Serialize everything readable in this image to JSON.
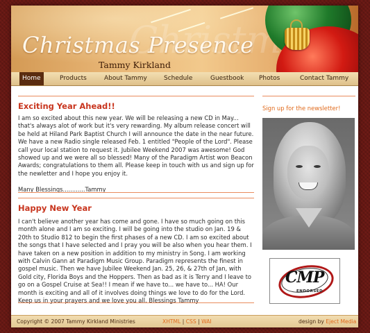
{
  "header": {
    "site_title": "Christmas Presence",
    "artist_name": "Tammy Kirkland",
    "ghost_text": "Christmas"
  },
  "nav": {
    "items": [
      {
        "label": "Home",
        "active": true
      },
      {
        "label": "Products",
        "active": false
      },
      {
        "label": "About Tammy",
        "active": false
      },
      {
        "label": "Schedule",
        "active": false
      },
      {
        "label": "Guestbook",
        "active": false
      },
      {
        "label": "Photos",
        "active": false
      },
      {
        "label": "Contact Tammy",
        "active": false
      }
    ]
  },
  "main": {
    "posts": [
      {
        "title": "Exciting Year Ahead!!",
        "body": "I am so excited about this new year. We will be releasing a new CD in May... that's always alot of work but it's very rewarding. My album release concert will be held at Hiland Park Baptist Church I will announce the date in the near future.\nWe have a new Radio single released Feb. 1 entitled \"People of the Lord\". Please call your local station to request it. Jubilee Weekend 2007 was awesome! God showed up and we were all so blessed! Many of the Paradigm Artist won Beacon Awards; congratulations to them all. Please keep in touch with us and sign up for the newletter and I hope you enjoy it.\n\nMany Blessings............Tammy"
      },
      {
        "title": "Happy New Year",
        "body": "I can't believe another year has come and gone. I have so much going on this month alone and I am so exciting. I will be going into the studio on Jan. 19 & 20th to Studio 812 to begin the first phases of a new CD. I am so excited about the songs that I have selected and I pray you will be also when you hear them. I have taken on a new position in addition to my ministry in Song. I am working with Calvin Gann at Paradigm Music Group. Paradigm represents the finest in gospel music. Then we have Jubilee Weekend Jan. 25, 26, & 27th of Jan, with Gold city, Florida Boys and the Hoppers. Then as bad as it is Terry and I leave to go on a Gospel Cruise at Sea!! I mean if we have to... we have to... HA! Our month is exciting and all of it involves doing things we love to do for the Lord. Keep us in your prayers and we love you all. Blessings Tammy"
      }
    ]
  },
  "sidebar": {
    "signup_link": "Sign up for the newsletter!",
    "logo_text": "CMP",
    "logo_subtext": "ENDORSED"
  },
  "footer": {
    "copyright": "Copyright © 2007 Tammy Kirkland Ministries",
    "link_xhtml": "XHTML",
    "link_css": "CSS",
    "link_wai": "WAI",
    "separator": "|",
    "design_label": "design by",
    "design_link": "Eject Media"
  },
  "colors": {
    "accent": "#c8351e",
    "link": "#e06a1c",
    "nav_active": "#5a2c10",
    "rule": "#e98b5c"
  }
}
